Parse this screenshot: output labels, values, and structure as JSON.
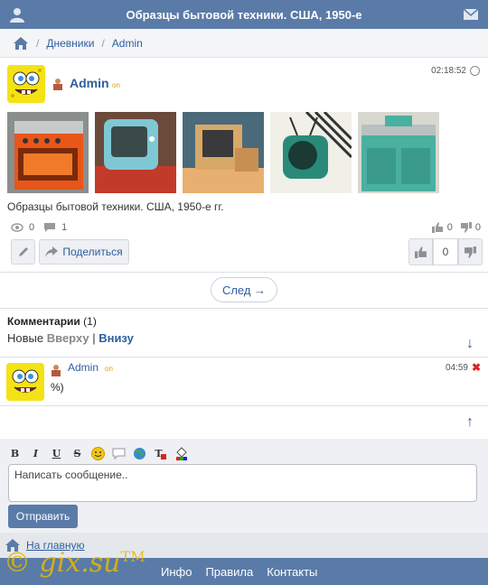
{
  "header": {
    "title": "Образцы бытовой техники. США, 1950-е"
  },
  "breadcrumb": {
    "items": [
      "Дневники",
      "Admin"
    ]
  },
  "post": {
    "author": "Admin",
    "online": "on",
    "time": "02:18:52",
    "caption": "Образцы бытовой техники. США, 1950-е гг.",
    "views": "0",
    "comments": "1",
    "likes": "0",
    "dislikes": "0",
    "share_label": "Поделиться",
    "rating": "0"
  },
  "nav": {
    "next_label": "След →"
  },
  "comments": {
    "title": "Комментарии",
    "count": "(1)",
    "sort_prefix": "Новые",
    "sort_up": "Вверху",
    "sort_sep": "|",
    "sort_down": "Внизу",
    "items": [
      {
        "author": "Admin",
        "online": "on",
        "time": "04:59",
        "text": "%)"
      }
    ]
  },
  "editor": {
    "placeholder": "Написать сообщение..",
    "send_label": "Отправить"
  },
  "home": {
    "label": "На главную"
  },
  "footer": {
    "links": [
      "Инфо",
      "Правила",
      "Контакты"
    ]
  },
  "watermark": {
    "text": "© gix.su",
    "tm": "TM"
  },
  "colors": {
    "header": "#5a7ba8",
    "link": "#2e5f9e",
    "background": "#eef0f3"
  }
}
